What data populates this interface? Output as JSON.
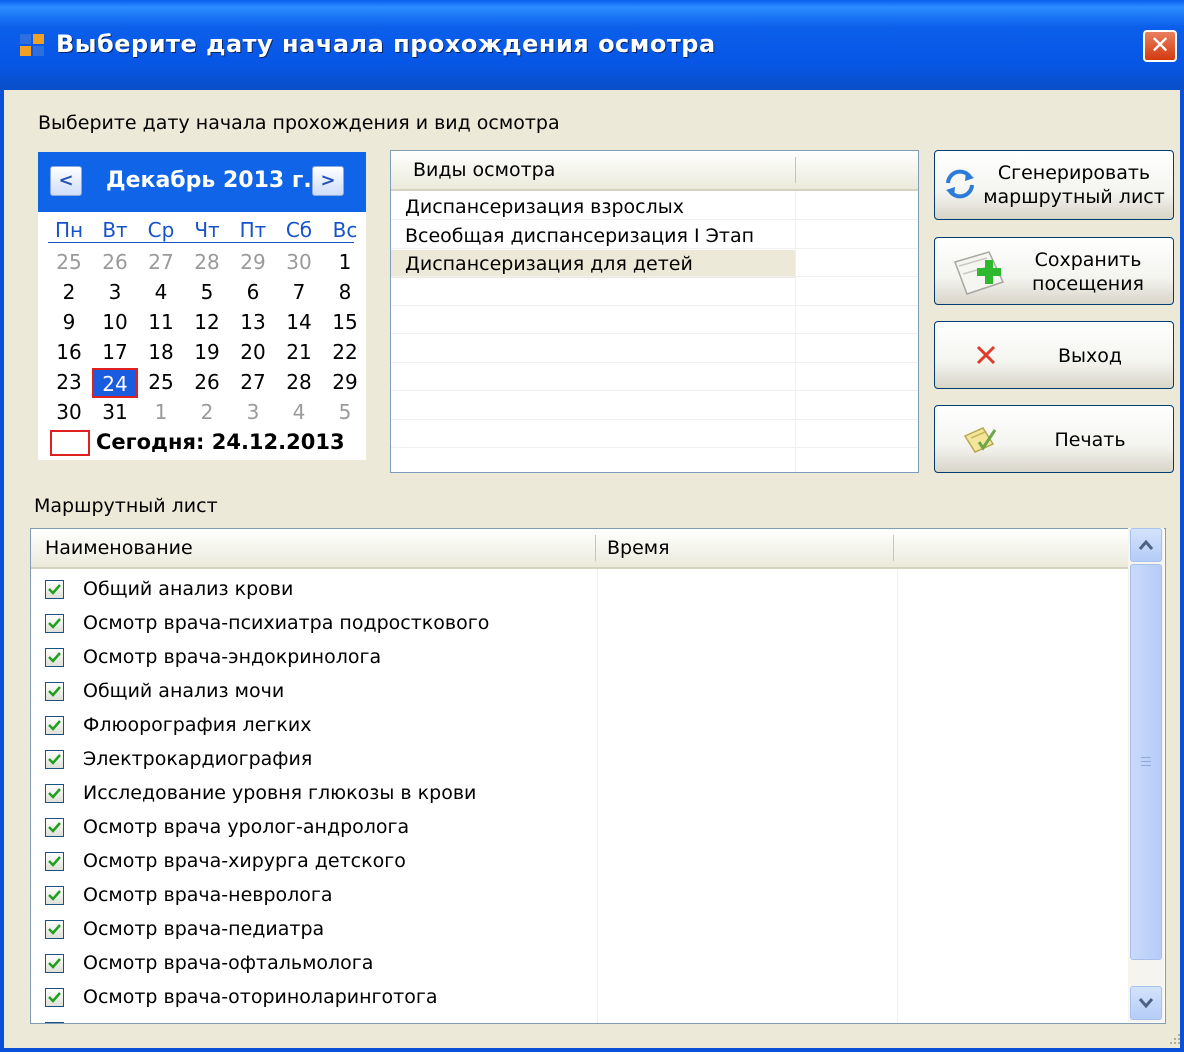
{
  "window": {
    "title": "Выберите дату начала прохождения осмотра",
    "close_glyph": "✕"
  },
  "subtitle": "Выберите дату начала прохождения и вид осмотра",
  "calendar": {
    "month_label": "Декабрь 2013 г.",
    "prev_glyph": "<",
    "next_glyph": ">",
    "weekdays": [
      "Пн",
      "Вт",
      "Ср",
      "Чт",
      "Пт",
      "Сб",
      "Вс"
    ],
    "weeks": [
      [
        "25",
        "26",
        "27",
        "28",
        "29",
        "30",
        "1"
      ],
      [
        "2",
        "3",
        "4",
        "5",
        "6",
        "7",
        "8"
      ],
      [
        "9",
        "10",
        "11",
        "12",
        "13",
        "14",
        "15"
      ],
      [
        "16",
        "17",
        "18",
        "19",
        "20",
        "21",
        "22"
      ],
      [
        "23",
        "24",
        "25",
        "26",
        "27",
        "28",
        "29"
      ],
      [
        "30",
        "31",
        "1",
        "2",
        "3",
        "4",
        "5"
      ]
    ],
    "selected_day": "24",
    "today_label": "Сегодня: 24.12.2013"
  },
  "exam_types": {
    "column_header": "Виды осмотра",
    "items": [
      "Диспансеризация взрослых",
      "Всеобщая диспансеризация I Этап",
      "Диспансеризация для детей"
    ],
    "selected_index": 2
  },
  "buttons": {
    "generate": {
      "line1": "Сгенерировать",
      "line2": "маршрутный лист"
    },
    "save": {
      "line1": "Сохранить",
      "line2": "посещения"
    },
    "exit": {
      "label": "Выход"
    },
    "print": {
      "label": "Печать"
    }
  },
  "route_sheet": {
    "label": "Маршрутный лист",
    "columns": [
      "Наименование",
      "Время"
    ],
    "rows": [
      {
        "name": "Общий анализ крови",
        "time": "",
        "checked": true
      },
      {
        "name": "Осмотр врача-психиатра подросткового",
        "time": "",
        "checked": true
      },
      {
        "name": "Осмотр врача-эндокринолога",
        "time": "",
        "checked": true
      },
      {
        "name": "Общий анализ мочи",
        "time": "",
        "checked": true
      },
      {
        "name": "Флюорография легких",
        "time": "",
        "checked": true
      },
      {
        "name": "Электрокардиография",
        "time": "",
        "checked": true
      },
      {
        "name": "Исследование уровня глюкозы в крови",
        "time": "",
        "checked": true
      },
      {
        "name": "Осмотр врача уролог-андролога",
        "time": "",
        "checked": true
      },
      {
        "name": "Осмотр врача-хирурга детского",
        "time": "",
        "checked": true
      },
      {
        "name": "Осмотр врача-невролога",
        "time": "",
        "checked": true
      },
      {
        "name": "Осмотр врача-педиатра",
        "time": "",
        "checked": true
      },
      {
        "name": "Осмотр врача-офтальмолога",
        "time": "",
        "checked": true
      },
      {
        "name": "Осмотр врача-оториноларинготога",
        "time": "",
        "checked": true
      }
    ]
  },
  "colors": {
    "titlebar": "#0756E6",
    "calendar_header": "#1064E8",
    "selection": "#1A5CE0",
    "today_border": "#E02020",
    "dialog_bg": "#ECE9D8"
  }
}
